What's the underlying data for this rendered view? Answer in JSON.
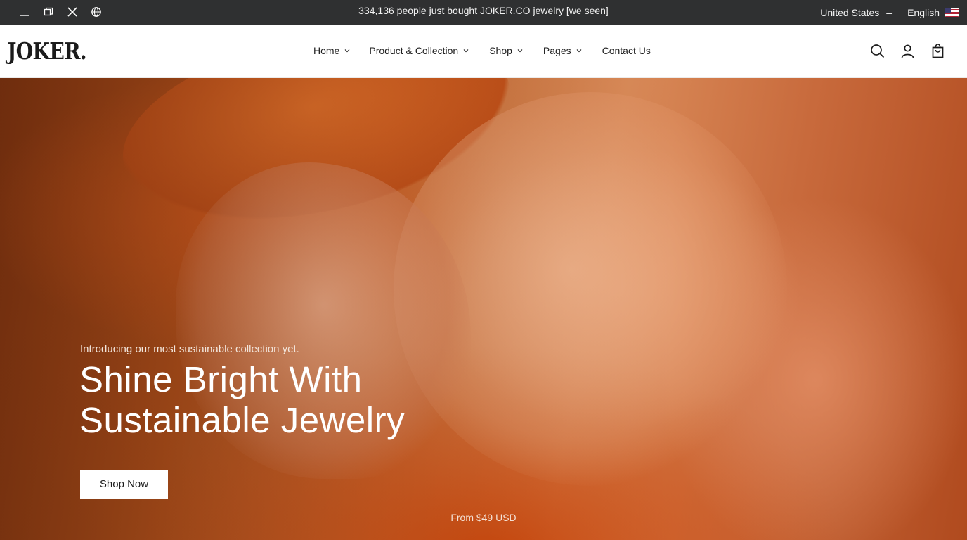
{
  "topbar": {
    "social_icons": [
      "minimize-icon",
      "window-icon",
      "x-icon",
      "globe-icon"
    ],
    "announcement": "334,136 people just bought JOKER.CO jewelry [we seen]",
    "country": "United States",
    "country_separator": "–",
    "language": "English",
    "flag_icon": "us-flag-icon"
  },
  "header": {
    "logo": "JOKER.",
    "nav": [
      {
        "label": "Home",
        "has_dropdown": true
      },
      {
        "label": "Product & Collection",
        "has_dropdown": true
      },
      {
        "label": "Shop",
        "has_dropdown": true
      },
      {
        "label": "Pages",
        "has_dropdown": true
      },
      {
        "label": "Contact Us",
        "has_dropdown": false
      }
    ],
    "icons": [
      "search-icon",
      "account-icon",
      "cart-icon"
    ]
  },
  "hero": {
    "intro": "Introducing our most sustainable collection yet.",
    "headline_line1": "Shine Bright With",
    "headline_line2": "Sustainable Jewelry",
    "cta": "Shop Now",
    "price": "From $49 USD"
  },
  "colors": {
    "topbar_bg": "#2f3031",
    "hero_accent": "#c9713a",
    "text_dark": "#1b1b1b"
  }
}
